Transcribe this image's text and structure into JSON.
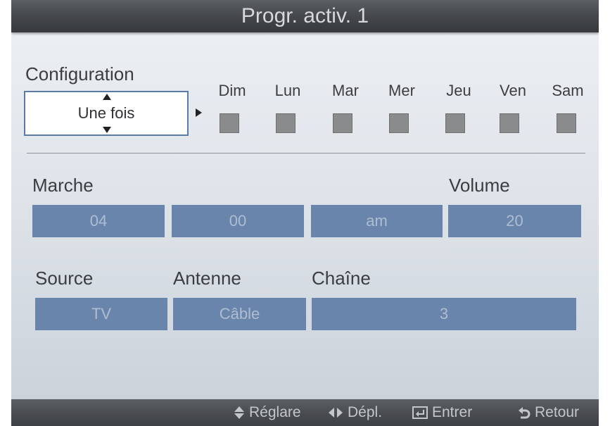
{
  "header": {
    "title": "Progr. activ. 1"
  },
  "configuration": {
    "label": "Configuration",
    "value": "Une fois"
  },
  "days": [
    {
      "label": "Dim",
      "checked": false
    },
    {
      "label": "Lun",
      "checked": false
    },
    {
      "label": "Mar",
      "checked": false
    },
    {
      "label": "Mer",
      "checked": false
    },
    {
      "label": "Jeu",
      "checked": false
    },
    {
      "label": "Ven",
      "checked": false
    },
    {
      "label": "Sam",
      "checked": false
    }
  ],
  "marche": {
    "label": "Marche",
    "hour": "04",
    "minute": "00",
    "ampm": "am"
  },
  "volume": {
    "label": "Volume",
    "value": "20"
  },
  "source": {
    "label": "Source",
    "value": "TV"
  },
  "antenne": {
    "label": "Antenne",
    "value": "Câble"
  },
  "chaine": {
    "label": "Chaîne",
    "value": "3"
  },
  "footer": {
    "adjust": "Réglare",
    "move": "Dépl.",
    "enter": "Entrer",
    "back": "Retour"
  },
  "colors": {
    "field_fill": "#6a85ab",
    "field_text": "#aebdd2",
    "select_border": "#5b7ba6",
    "bar": "#46494d"
  }
}
